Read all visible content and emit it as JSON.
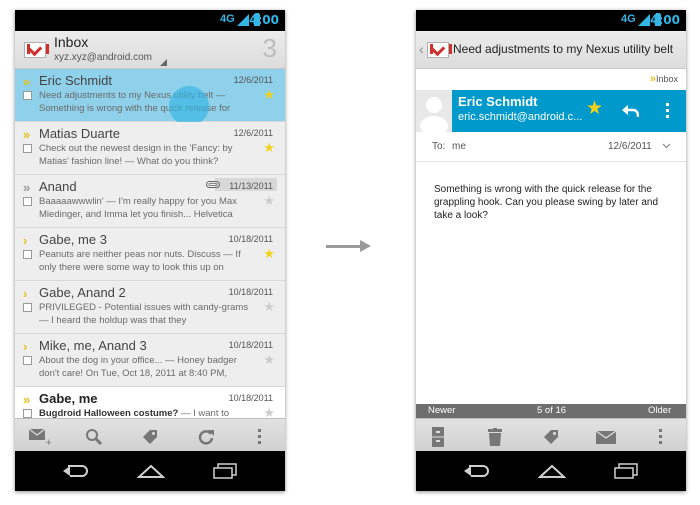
{
  "status": {
    "time": "4:00",
    "network": "4G"
  },
  "inbox": {
    "title": "Inbox",
    "account": "xyz.xyz@android.com",
    "unread_count": "3",
    "messages": [
      {
        "sender": "Eric Schmidt",
        "date": "12/6/2011",
        "snippet": "Need adjustments to my Nexus utility belt — Something is wrong with the quick release for",
        "starred": true
      },
      {
        "sender": "Matias Duarte",
        "date": "12/6/2011",
        "snippet": "Check out the newest design in the 'Fancy: by Matias' fashion line! — What do you think?",
        "starred": true
      },
      {
        "sender": "Anand",
        "date": "11/13/2011",
        "snippet": "Baaaaawwwlin' — I'm really happy for you Max Miedinger, and Imma let you finish... Helvetica",
        "starred": false
      },
      {
        "sender": "Gabe, me  3",
        "date": "10/18/2011",
        "snippet": "Peanuts are neither peas nor nuts. Discuss — If only there were some way to look this up on",
        "starred": true
      },
      {
        "sender": "Gabe, Anand  2",
        "date": "10/18/2011",
        "snippet": "PRIVILEGED - Potential issues with candy-grams — I heard the holdup was that they",
        "starred": false
      },
      {
        "sender": "Mike, me, Anand  3",
        "date": "10/18/2011",
        "snippet": "About the dog in your office... — Honey badger don't care! On Tue, Oct 18, 2011 at 8:40 PM,",
        "starred": false
      },
      {
        "sender": "Gabe, me",
        "date": "10/18/2011",
        "subject": "Bugdroid Halloween costume?",
        "snippet": " — I want to",
        "starred": false
      }
    ]
  },
  "detail": {
    "subject": "Need adjustments to my Nexus utility belt",
    "label": "Inbox",
    "sender_name": "Eric Schmidt",
    "sender_email": "eric.schmidt@android.c...",
    "to_label": "To:",
    "to_value": "me",
    "date": "12/6/2011",
    "body": "Something is wrong with the quick release for the grappling hook. Can you please swing by later and take a look?",
    "newer": "Newer",
    "position": "5 of 16",
    "older": "Older"
  },
  "colors": {
    "accent": "#0099cc",
    "selected": "#8fd0ea",
    "star": "#f0d21a",
    "status_text": "#33b5e5"
  }
}
